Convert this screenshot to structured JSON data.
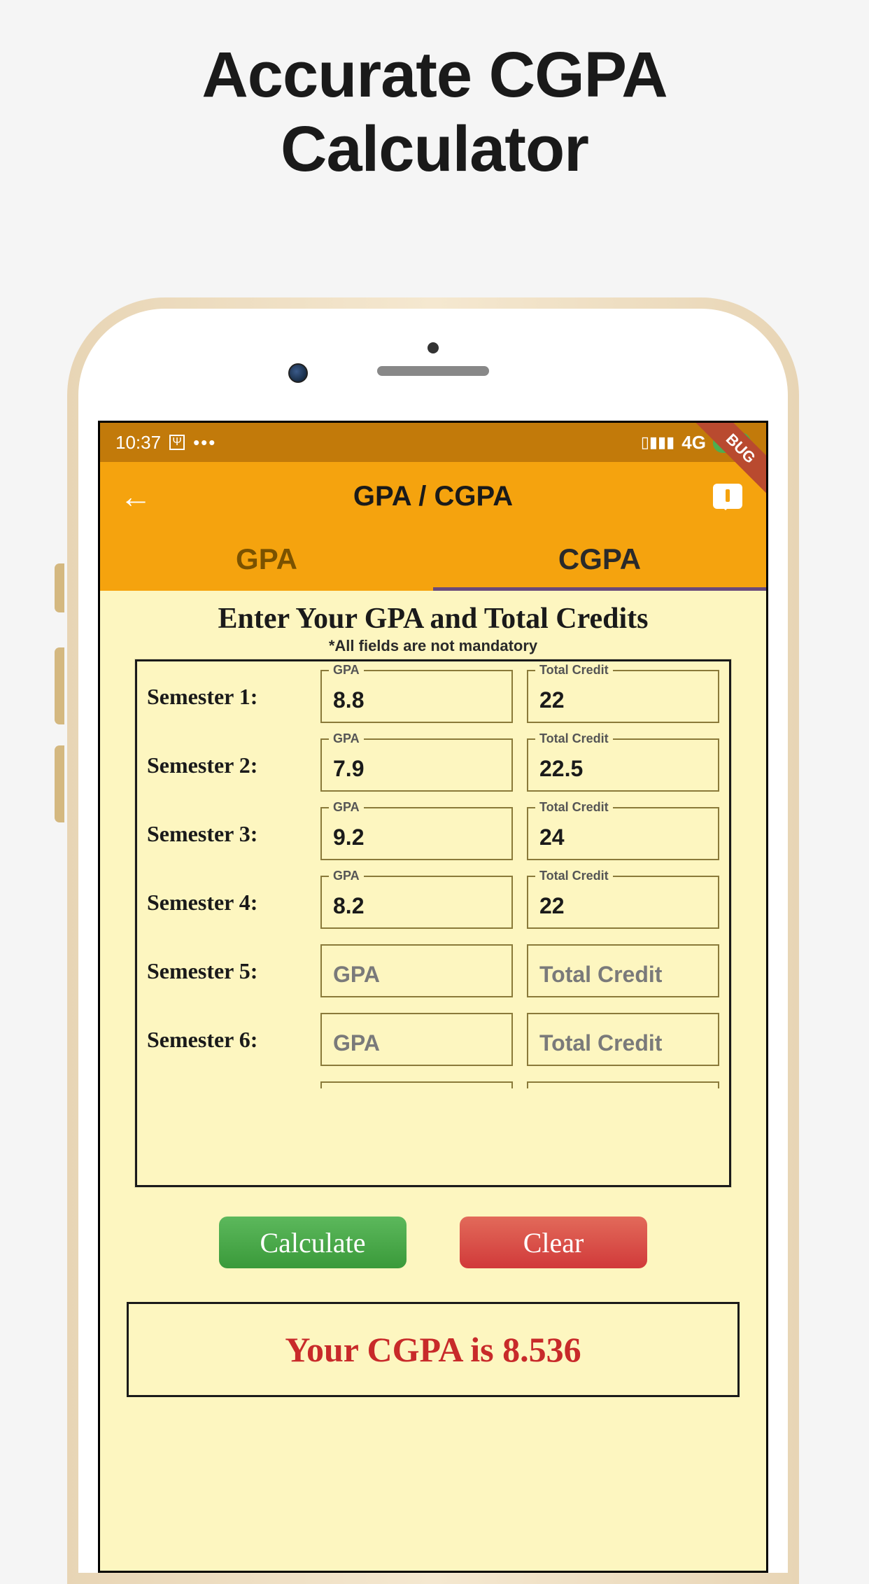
{
  "marketing_title_line1": "Accurate CGPA",
  "marketing_title_line2": "Calculator",
  "status": {
    "time": "10:37",
    "dots": "•••",
    "network": "4G",
    "battery": "100",
    "bug_ribbon": "BUG"
  },
  "header": {
    "title": "GPA / CGPA"
  },
  "tabs": [
    {
      "label": "GPA",
      "active": false
    },
    {
      "label": "CGPA",
      "active": true
    }
  ],
  "form": {
    "heading": "Enter Your GPA and Total Credits",
    "note": "*All fields are not mandatory",
    "gpa_label": "GPA",
    "credit_label": "Total Credit",
    "gpa_placeholder": "GPA",
    "credit_placeholder": "Total Credit",
    "semesters": [
      {
        "label": "Semester 1:",
        "gpa": "8.8",
        "credit": "22"
      },
      {
        "label": "Semester 2:",
        "gpa": "7.9",
        "credit": "22.5"
      },
      {
        "label": "Semester 3:",
        "gpa": "9.2",
        "credit": "24"
      },
      {
        "label": "Semester 4:",
        "gpa": "8.2",
        "credit": "22"
      },
      {
        "label": "Semester 5:",
        "gpa": "",
        "credit": ""
      },
      {
        "label": "Semester 6:",
        "gpa": "",
        "credit": ""
      }
    ]
  },
  "buttons": {
    "calculate": "Calculate",
    "clear": "Clear"
  },
  "result": "Your CGPA is 8.536"
}
